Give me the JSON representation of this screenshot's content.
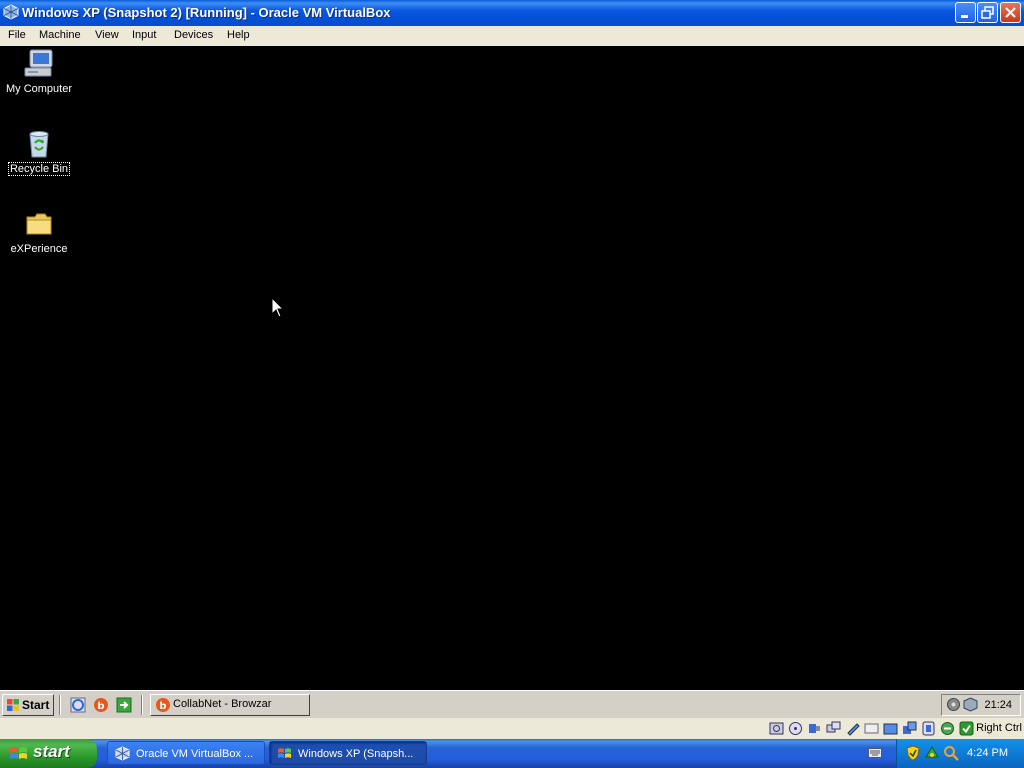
{
  "window": {
    "title": "Windows XP (Snapshot 2) [Running] - Oracle VM VirtualBox",
    "icon": "virtualbox-icon"
  },
  "menu": [
    "File",
    "Machine",
    "View",
    "Input",
    "Devices",
    "Help"
  ],
  "desktop": {
    "icons": [
      {
        "label": "My Computer",
        "icon": "my-computer-icon",
        "selected": false
      },
      {
        "label": "Recycle Bin",
        "icon": "recycle-bin-icon",
        "selected": true
      },
      {
        "label": "eXPerience",
        "icon": "folder-icon",
        "selected": false
      }
    ]
  },
  "guest_taskbar": {
    "start_label": "Start",
    "quick_launch": [
      "ie-icon",
      "browzar-icon",
      "show-desktop-icon"
    ],
    "task": {
      "label": "CollabNet - Browzar",
      "icon": "browzar-icon"
    },
    "clock": "21:24"
  },
  "vbox_status": {
    "indicators": [
      "hard-disk-icon",
      "optical-drive-icon",
      "usb-icon",
      "network-icon",
      "shared-folders-icon",
      "display-icon",
      "video-capture-icon",
      "mouse-integration-icon",
      "virtualization-icon",
      "cpu-icon",
      "hostkey-icon"
    ],
    "host_key": "Right Ctrl"
  },
  "host_taskbar": {
    "start_label": "start",
    "tasks": [
      {
        "label": "Oracle VM VirtualBox ...",
        "icon": "virtualbox-icon",
        "active": false
      },
      {
        "label": "Windows XP (Snapsh...",
        "icon": "virtualbox-vm-icon",
        "active": true
      }
    ],
    "tray_icons": [
      "security-shield-icon",
      "network-tray-icon",
      "search-tray-icon"
    ],
    "clock": "4:24 PM"
  },
  "colors": {
    "xp_blue": "#0a58e0",
    "start_green": "#3c9a3c",
    "classic_gray": "#d4d0c8",
    "menu_beige": "#ece9d8"
  }
}
